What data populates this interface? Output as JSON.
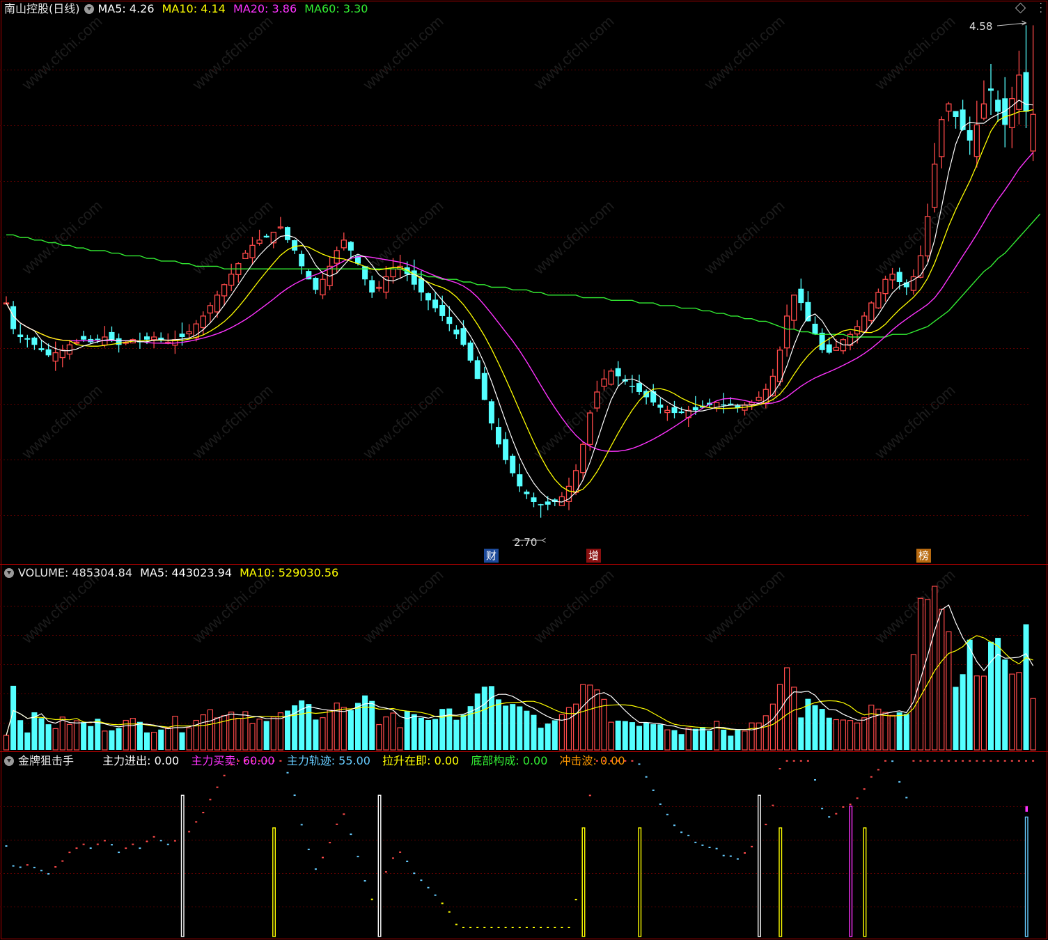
{
  "colors": {
    "up": "#ff4a4a",
    "down": "#54ffff",
    "ma5": "#ffffff",
    "ma10": "#ffff00",
    "ma20": "#ff33ff",
    "ma60": "#33ee33",
    "grid": "#5a0000",
    "border": "#b00000",
    "orange": "#ff9900",
    "lightblue": "#66ccff"
  },
  "price_panel": {
    "stock": "南山控股(日线)",
    "ma5": "MA5: 4.26",
    "ma10": "MA10: 4.14",
    "ma20": "MA20: 3.86",
    "ma60": "MA60: 3.30",
    "high_label": "4.58",
    "low_label": "2.70",
    "events": [
      "财",
      "增",
      "榜"
    ]
  },
  "volume_panel": {
    "volume": "VOLUME: 485304.84",
    "ma5": "MA5: 443023.94",
    "ma10": "MA10: 529030.56"
  },
  "indicator_panel": {
    "name": "金牌狙击手",
    "f1": "主力进出: 0.00",
    "f2": "主力买卖: 60.00",
    "f3": "主力轨迹: 55.00",
    "f4": "拉升在即: 0.00",
    "f5": "底部构成: 0.00",
    "f6": "冲击波: 0.00"
  },
  "watermark": "www.cfchi.com",
  "chart_data": {
    "type": "candlestick",
    "price_scale": [
      2.55,
      4.65
    ],
    "close": [
      3.52,
      3.42,
      3.39,
      3.38,
      3.36,
      3.34,
      3.32,
      3.33,
      3.34,
      3.36,
      3.37,
      3.38,
      3.37,
      3.38,
      3.39,
      3.38,
      3.36,
      3.37,
      3.38,
      3.37,
      3.38,
      3.39,
      3.38,
      3.37,
      3.38,
      3.39,
      3.41,
      3.44,
      3.47,
      3.51,
      3.55,
      3.59,
      3.63,
      3.67,
      3.71,
      3.74,
      3.76,
      3.77,
      3.79,
      3.81,
      3.76,
      3.72,
      3.66,
      3.61,
      3.57,
      3.61,
      3.66,
      3.72,
      3.76,
      3.72,
      3.67,
      3.61,
      3.56,
      3.58,
      3.62,
      3.65,
      3.66,
      3.63,
      3.59,
      3.56,
      3.53,
      3.5,
      3.47,
      3.44,
      3.4,
      3.36,
      3.3,
      3.23,
      3.15,
      3.06,
      2.98,
      2.92,
      2.87,
      2.82,
      2.79,
      2.76,
      2.75,
      2.75,
      2.76,
      2.78,
      2.82,
      2.88,
      2.98,
      3.1,
      3.18,
      3.23,
      3.26,
      3.24,
      3.22,
      3.2,
      3.18,
      3.16,
      3.14,
      3.12,
      3.11,
      3.1,
      3.1,
      3.11,
      3.11,
      3.12,
      3.13,
      3.14,
      3.13,
      3.13,
      3.12,
      3.13,
      3.14,
      3.16,
      3.19,
      3.24,
      3.34,
      3.47,
      3.55,
      3.52,
      3.45,
      3.4,
      3.34,
      3.33,
      3.35,
      3.38,
      3.4,
      3.43,
      3.47,
      3.52,
      3.56,
      3.61,
      3.63,
      3.6,
      3.58,
      3.62,
      3.7,
      3.85,
      4.05,
      4.22,
      4.28,
      4.23,
      4.18,
      4.14,
      4.2,
      4.28,
      4.33,
      4.25,
      4.2,
      4.3,
      4.39,
      4.25,
      4.24
    ],
    "ma60": [
      3.78,
      3.78,
      3.77,
      3.77,
      3.76,
      3.76,
      3.75,
      3.75,
      3.74,
      3.74,
      3.73,
      3.73,
      3.72,
      3.72,
      3.72,
      3.71,
      3.71,
      3.7,
      3.7,
      3.7,
      3.69,
      3.69,
      3.68,
      3.68,
      3.68,
      3.67,
      3.67,
      3.66,
      3.66,
      3.66,
      3.66,
      3.65,
      3.65,
      3.65,
      3.65,
      3.65,
      3.65,
      3.65,
      3.65,
      3.65,
      3.65,
      3.65,
      3.65,
      3.65,
      3.65,
      3.65,
      3.65,
      3.65,
      3.65,
      3.65,
      3.65,
      3.65,
      3.65,
      3.65,
      3.65,
      3.65,
      3.65,
      3.64,
      3.63,
      3.63,
      3.62,
      3.62,
      3.61,
      3.61,
      3.61,
      3.6,
      3.6,
      3.59,
      3.59,
      3.58,
      3.58,
      3.58,
      3.57,
      3.57,
      3.57,
      3.56,
      3.56,
      3.55,
      3.55,
      3.55,
      3.55,
      3.55,
      3.54,
      3.54,
      3.54,
      3.54,
      3.53,
      3.53,
      3.53,
      3.53,
      3.52,
      3.52,
      3.52,
      3.51,
      3.51,
      3.51,
      3.5,
      3.5,
      3.5,
      3.49,
      3.49,
      3.48,
      3.48,
      3.47,
      3.47,
      3.46,
      3.46,
      3.45,
      3.45,
      3.44,
      3.43,
      3.42,
      3.42,
      3.41,
      3.41,
      3.4,
      3.4,
      3.4,
      3.4,
      3.4,
      3.39,
      3.39,
      3.39,
      3.39,
      3.39,
      3.39,
      3.4,
      3.4,
      3.4,
      3.41,
      3.42,
      3.43,
      3.45,
      3.47,
      3.49,
      3.52,
      3.55,
      3.58,
      3.61,
      3.64,
      3.66,
      3.69,
      3.71,
      3.74,
      3.77,
      3.8,
      3.83,
      3.86
    ]
  }
}
